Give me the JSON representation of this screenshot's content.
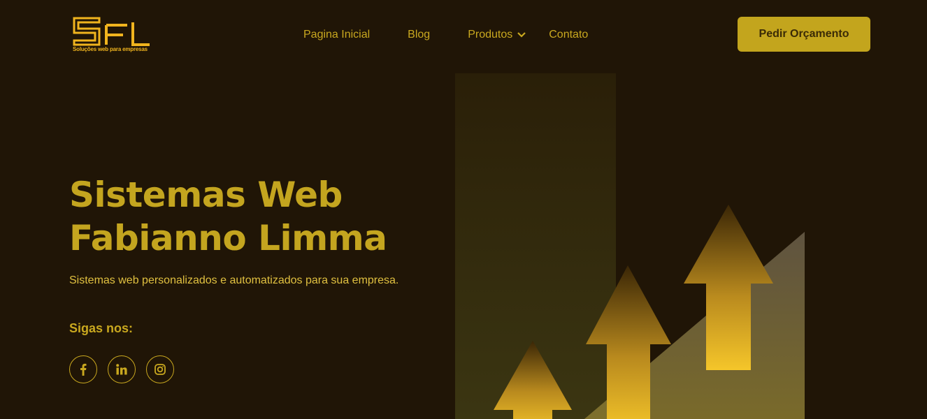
{
  "brand": {
    "logo_text": "SFL",
    "tagline": "Soluções web para empresas",
    "accent_color": "#c4a51f",
    "logo_color": "#f0b41e",
    "background_color": "#201506"
  },
  "nav": {
    "items": [
      {
        "label": "Pagina Inicial"
      },
      {
        "label": "Blog"
      },
      {
        "label": "Produtos",
        "has_dropdown": true
      },
      {
        "label": "Contato"
      }
    ]
  },
  "cta": {
    "label": "Pedir Orçamento"
  },
  "hero": {
    "title_line1": "Sistemas Web",
    "title_line2": "Fabianno Limma",
    "subtitle": "Sistemas web personalizados e automatizados para sua empresa."
  },
  "social": {
    "label": "Sigas nos:",
    "icons": [
      "facebook-icon",
      "linkedin-icon",
      "instagram-icon"
    ]
  },
  "illustration": {
    "icons": [
      "growth-arrow-icon",
      "growth-arrow-icon",
      "growth-arrow-icon"
    ]
  }
}
